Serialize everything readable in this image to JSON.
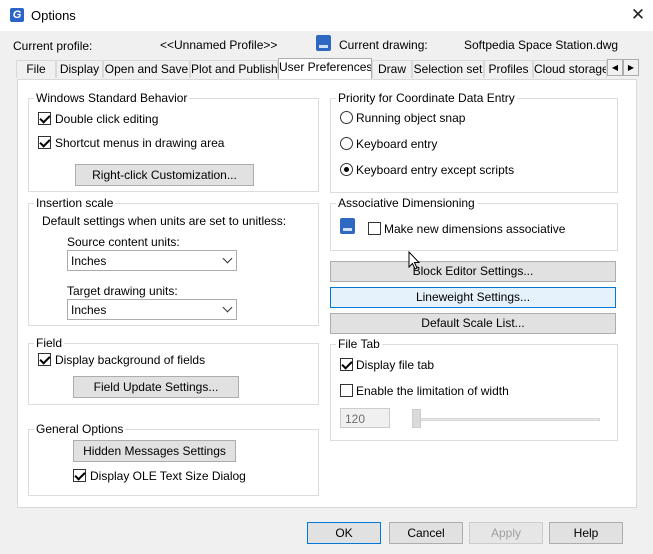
{
  "window": {
    "title": "Options",
    "close_glyph": "✕"
  },
  "header": {
    "current_profile_label": "Current profile:",
    "current_profile_value": "<<Unnamed Profile>>",
    "current_drawing_label": "Current drawing:",
    "current_drawing_value": "Softpedia Space Station.dwg"
  },
  "tabs": [
    {
      "label": "File"
    },
    {
      "label": "Display"
    },
    {
      "label": "Open and Save"
    },
    {
      "label": "Plot and Publish"
    },
    {
      "label": "User Preferences",
      "active": true
    },
    {
      "label": "Draw"
    },
    {
      "label": "Selection set"
    },
    {
      "label": "Profiles"
    },
    {
      "label": "Cloud storage"
    }
  ],
  "tab_scroll": {
    "left": "◀",
    "right": "▶"
  },
  "windows_behavior": {
    "title": "Windows Standard Behavior",
    "double_click_label": "Double click editing",
    "double_click_checked": true,
    "shortcut_menus_label": "Shortcut menus in drawing area",
    "shortcut_menus_checked": true,
    "right_click_button": "Right-click Customization..."
  },
  "insertion_scale": {
    "title": "Insertion scale",
    "description": "Default settings when units are set to unitless:",
    "source_label": "Source content units:",
    "source_value": "Inches",
    "target_label": "Target drawing units:",
    "target_value": "Inches"
  },
  "field": {
    "title": "Field",
    "display_bg_label": "Display background of fields",
    "display_bg_checked": true,
    "update_button": "Field Update Settings..."
  },
  "general_options": {
    "title": "General Options",
    "hidden_messages_button": "Hidden Messages Settings",
    "ole_label": "Display OLE Text Size Dialog",
    "ole_checked": true
  },
  "priority": {
    "title": "Priority for Coordinate Data Entry",
    "options": [
      {
        "label": "Running object snap",
        "selected": false
      },
      {
        "label": "Keyboard entry",
        "selected": false
      },
      {
        "label": "Keyboard entry except scripts",
        "selected": true
      }
    ]
  },
  "associative": {
    "title": "Associative Dimensioning",
    "make_assoc_label": "Make new dimensions associative",
    "make_assoc_checked": false
  },
  "side_buttons": {
    "block_editor": "Block Editor Settings...",
    "lineweight": "Lineweight Settings...",
    "default_scale": "Default Scale List..."
  },
  "file_tab": {
    "title": "File Tab",
    "display_label": "Display file tab",
    "display_checked": true,
    "limit_label": "Enable the limitation of width",
    "limit_checked": false,
    "width_value": "120",
    "slider_fraction": 0
  },
  "footer": {
    "ok": "OK",
    "cancel": "Cancel",
    "apply": "Apply",
    "help": "Help"
  },
  "colors": {
    "accent": "#0078d7",
    "icon_blue": "#2f68c3"
  }
}
